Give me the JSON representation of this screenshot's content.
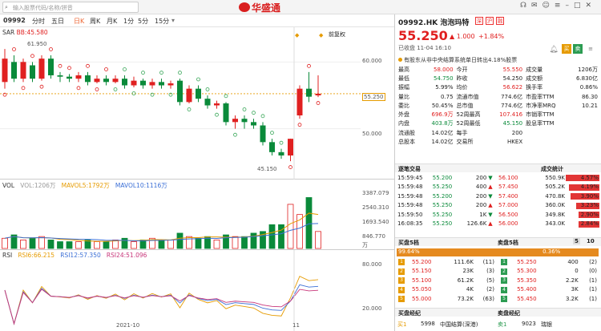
{
  "app": {
    "search_placeholder": "输入股票代码/名称/拼音",
    "logo": "华盛通"
  },
  "toolbar": {
    "code": "09992",
    "tabs": [
      "分时",
      "五日",
      "日K",
      "周K",
      "月K",
      "1分",
      "5分",
      "15分"
    ],
    "active": "日K"
  },
  "main_chart": {
    "indicator": "SAR",
    "value_label": "BB:45.580",
    "high_label": "61.950",
    "low_label": "45.150",
    "adjust": "前复权",
    "price_tag": "55.250",
    "y_labels": [
      "60.000",
      "50.000"
    ]
  },
  "vol_panel": {
    "name": "VOL",
    "vol": "VOL:1206万",
    "ma5": "MAVOL5:1792万",
    "ma10": "MAVOL10:1116万",
    "y_labels": [
      "3387.079",
      "2540.310",
      "1693.540",
      "846.770",
      "万"
    ]
  },
  "rsi_panel": {
    "name": "RSI",
    "rsi6": "RSI6:66.215",
    "rsi12": "RSI12:57.350",
    "rsi24": "RSI24:51.096",
    "y_labels": [
      "80.000",
      "20.000"
    ],
    "x_labels": [
      "2021-10",
      "11"
    ]
  },
  "candles": [
    {
      "o": 57.0,
      "c": 60.5,
      "h": 61.95,
      "l": 56.0
    },
    {
      "o": 60.0,
      "c": 57.5,
      "h": 61.0,
      "l": 57.0
    },
    {
      "o": 57.5,
      "c": 60.0,
      "h": 60.5,
      "l": 57.0
    },
    {
      "o": 59.5,
      "c": 57.5,
      "h": 60.0,
      "l": 57.0
    },
    {
      "o": 57.5,
      "c": 60.5,
      "h": 61.0,
      "l": 57.2
    },
    {
      "o": 60.5,
      "c": 58.0,
      "h": 61.0,
      "l": 57.5
    },
    {
      "o": 58.0,
      "c": 57.8,
      "h": 58.5,
      "l": 57.0
    },
    {
      "o": 57.8,
      "c": 57.5,
      "h": 58.2,
      "l": 57.0
    },
    {
      "o": 57.5,
      "c": 58.0,
      "h": 58.5,
      "l": 57.0
    },
    {
      "o": 58.0,
      "c": 57.0,
      "h": 58.5,
      "l": 56.5
    },
    {
      "o": 57.0,
      "c": 57.5,
      "h": 58.0,
      "l": 56.8
    },
    {
      "o": 57.5,
      "c": 57.0,
      "h": 58.0,
      "l": 56.5
    },
    {
      "o": 57.0,
      "c": 57.5,
      "h": 58.0,
      "l": 56.8
    },
    {
      "o": 57.5,
      "c": 56.5,
      "h": 58.0,
      "l": 56.0
    },
    {
      "o": 56.5,
      "c": 57.2,
      "h": 57.8,
      "l": 56.2
    },
    {
      "o": 57.2,
      "c": 56.5,
      "h": 57.5,
      "l": 56.0
    },
    {
      "o": 56.5,
      "c": 57.0,
      "h": 57.5,
      "l": 56.0
    },
    {
      "o": 57.0,
      "c": 56.5,
      "h": 57.5,
      "l": 56.0
    },
    {
      "o": 56.5,
      "c": 56.8,
      "h": 57.2,
      "l": 56.0
    },
    {
      "o": 57.2,
      "c": 54.0,
      "h": 57.5,
      "l": 53.5
    },
    {
      "o": 54.0,
      "c": 56.0,
      "h": 56.5,
      "l": 53.8
    },
    {
      "o": 56.0,
      "c": 54.5,
      "h": 56.5,
      "l": 54.0
    },
    {
      "o": 54.5,
      "c": 53.5,
      "h": 55.0,
      "l": 53.0
    },
    {
      "o": 53.5,
      "c": 53.8,
      "h": 54.2,
      "l": 53.0
    },
    {
      "o": 53.8,
      "c": 51.0,
      "h": 54.0,
      "l": 50.5
    },
    {
      "o": 51.0,
      "c": 51.5,
      "h": 52.0,
      "l": 50.0
    },
    {
      "o": 51.5,
      "c": 51.0,
      "h": 52.0,
      "l": 50.0
    },
    {
      "o": 51.0,
      "c": 50.5,
      "h": 51.5,
      "l": 50.0
    },
    {
      "o": 50.5,
      "c": 48.0,
      "h": 51.0,
      "l": 47.5
    },
    {
      "o": 48.0,
      "c": 46.5,
      "h": 48.5,
      "l": 46.0
    },
    {
      "o": 46.5,
      "c": 46.0,
      "h": 47.0,
      "l": 45.5
    },
    {
      "o": 46.0,
      "c": 48.5,
      "h": 48.5,
      "l": 45.15
    },
    {
      "o": 52.0,
      "c": 56.0,
      "h": 56.5,
      "l": 51.5
    },
    {
      "o": 56.0,
      "c": 54.8,
      "h": 58.5,
      "l": 54.0
    },
    {
      "o": 55.0,
      "c": 55.25,
      "h": 58.0,
      "l": 54.75
    }
  ],
  "volumes": [
    6,
    8,
    5,
    6,
    7,
    5,
    4,
    4,
    4,
    5,
    4,
    4,
    5,
    6,
    4,
    5,
    6,
    5,
    5,
    9,
    7,
    6,
    7,
    5,
    8,
    7,
    7,
    9,
    10,
    14,
    14,
    26,
    20,
    30,
    10
  ],
  "quote": {
    "name": "09992.HK 泡泡玛特",
    "tags": [
      "深",
      "沪",
      "融"
    ],
    "price": "55.250",
    "change": "1.000",
    "pct": "+1.84%",
    "meta": "已收盘 11-04 16:10",
    "news": "有股东从非中央结算系统单日转出4.18%股票",
    "rows": [
      [
        "最高",
        "58.000",
        "今开",
        "55.550",
        "成交量",
        "1206万"
      ],
      [
        "最低",
        "54.750",
        "昨收",
        "54.250",
        "成交额",
        "6.830亿"
      ],
      [
        "振幅",
        "5.99%",
        "均价",
        "56.622",
        "换手率",
        "0.86%"
      ],
      [
        "量比",
        "0.75",
        "流通市值",
        "774.6亿",
        "市盈率TTM",
        "86.30"
      ],
      [
        "委比",
        "50.45%",
        "总市值",
        "774.6亿",
        "市净率MRQ",
        "10.21"
      ],
      [
        "外盘",
        "696.9万",
        "52周最高",
        "107.416",
        "市销率TTM",
        ""
      ],
      [
        "内盘",
        "403.8万",
        "52周最低",
        "45.150",
        "股息率TTM",
        ""
      ],
      [
        "流通股",
        "14.02亿",
        "每手",
        "200",
        "",
        ""
      ],
      [
        "总股本",
        "14.02亿",
        "交易所",
        "HKEX",
        "",
        ""
      ]
    ]
  },
  "trades": {
    "title": "逐笔交易",
    "rows": [
      [
        "15:59:45",
        "55.200",
        "200"
      ],
      [
        "15:59:48",
        "55.250",
        "400"
      ],
      [
        "15:59:48",
        "55.200",
        "200"
      ],
      [
        "15:59:48",
        "55.250",
        "200"
      ],
      [
        "15:59:50",
        "55.250",
        "1K"
      ],
      [
        "16:08:35",
        "55.250",
        "126.6K"
      ]
    ]
  },
  "stats": {
    "title": "成交统计",
    "rows": [
      [
        "56.100",
        "550.9K",
        "4.57%"
      ],
      [
        "57.450",
        "505.2K",
        "4.19%"
      ],
      [
        "57.400",
        "470.8K",
        "3.90%"
      ],
      [
        "57.000",
        "360.0K",
        "3.23%"
      ],
      [
        "56.500",
        "349.8K",
        "2.90%"
      ],
      [
        "56.000",
        "343.0K",
        "2.84%"
      ]
    ]
  },
  "book": {
    "buy_title": "买盘5档",
    "sell_title": "卖盘5档",
    "buy_pct": "99.64%",
    "sell_pct": "0.36%",
    "level_btn": "5",
    "alt_btn": "10",
    "buy": [
      [
        "1",
        "55.200",
        "111.6K",
        "(11)"
      ],
      [
        "2",
        "55.150",
        "23K",
        "(3)"
      ],
      [
        "3",
        "55.100",
        "61.2K",
        "(5)"
      ],
      [
        "4",
        "55.050",
        "4K",
        "(2)"
      ],
      [
        "5",
        "55.000",
        "73.2K",
        "(63)"
      ]
    ],
    "sell": [
      [
        "1",
        "55.250",
        "400",
        "(2)"
      ],
      [
        "2",
        "55.300",
        "0",
        "(0)"
      ],
      [
        "3",
        "55.350",
        "2.2K",
        "(1)"
      ],
      [
        "4",
        "55.400",
        "3K",
        "(1)"
      ],
      [
        "5",
        "55.450",
        "3.2K",
        "(1)"
      ]
    ]
  },
  "broker": {
    "buy_title": "买盘经纪",
    "sell_title": "卖盘经纪",
    "buy_row": [
      "买1",
      "5998",
      "中国结算(深港)"
    ],
    "sell_row": [
      "卖1",
      "9023",
      "瑞银"
    ]
  },
  "colors": {
    "up": "#e02020",
    "down": "#0a8a3a",
    "sar": "#e02020"
  }
}
